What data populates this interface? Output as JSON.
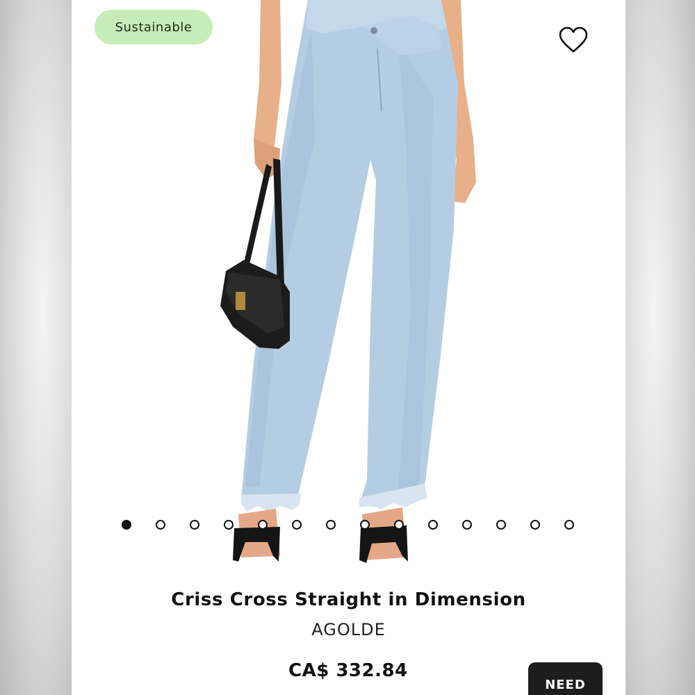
{
  "badge": {
    "label": "Sustainable"
  },
  "favorite": {
    "icon": "heart-outline-icon"
  },
  "product_image": {
    "description_icon": "jeans-photo"
  },
  "carousel": {
    "total": 14,
    "active_index": 0
  },
  "product": {
    "title": "Criss Cross Straight in Dimension",
    "brand": "AGOLDE",
    "price": "CA$ 332.84"
  },
  "actions": {
    "need_label": "NEED"
  },
  "colors": {
    "badge_bg": "#c8ecb7",
    "button_bg": "#1d1d1d",
    "denim": "#b5cde3"
  }
}
